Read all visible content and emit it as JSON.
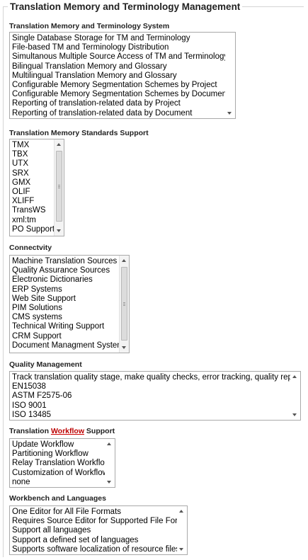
{
  "legend": "Translation Memory and Terminology Management",
  "sections": [
    {
      "title": "Translation Memory and Terminology System",
      "items": [
        "Single Database Storage for TM and Terminology",
        "File-based TM and Terminology Distribution",
        "Simultanous Multiple Source Access of TM and Terminology Use",
        "Bilingual Translation Memory and Glossary",
        "Multilingual Translation Memory and Glossary",
        "Configurable Memory Segmentation Schemes by Project",
        "Configurable Memory Segmentation Schemes by Document",
        "Reporting of translation-related data by Project",
        "Reporting of translation-related data by Document"
      ]
    },
    {
      "title": "Translation Memory Standards Support",
      "items": [
        "TMX",
        "TBX",
        "UTX",
        "SRX",
        "GMX",
        "OLIF",
        "XLIFF",
        "TransWS",
        "xml:tm",
        "PO Support"
      ]
    },
    {
      "title": "Connectvity",
      "items": [
        "Machine Translation Sources",
        "Quality Assurance Sources",
        "Electronic Dictionaries",
        "ERP Systems",
        "Web Site Support",
        "PIM Solutions",
        "CMS systems",
        "Technical Writing Support",
        "CRM Support",
        "Document Managment Systems"
      ]
    },
    {
      "title": "Quality Management",
      "items": [
        "Track translation quality stage, make quality checks, error tracking, quality reporting",
        "EN15038",
        "ASTM F2575-06",
        "ISO 9001",
        "ISO 13485"
      ]
    },
    {
      "title_before": "Translation ",
      "title_underlined": "Workflow",
      "title_after": " Support",
      "items": [
        "Update Workflow",
        "Partitioning Workflow",
        "Relay Translation Workflow",
        "Customization of Workflows",
        "none"
      ]
    },
    {
      "title": "Workbench and Languages",
      "items": [
        "One Editor for All File Formats",
        "Requires Source Editor for Supported File Format",
        "Support all languages",
        "Support a defined set of languages",
        "Supports software localization of resource files"
      ]
    }
  ]
}
